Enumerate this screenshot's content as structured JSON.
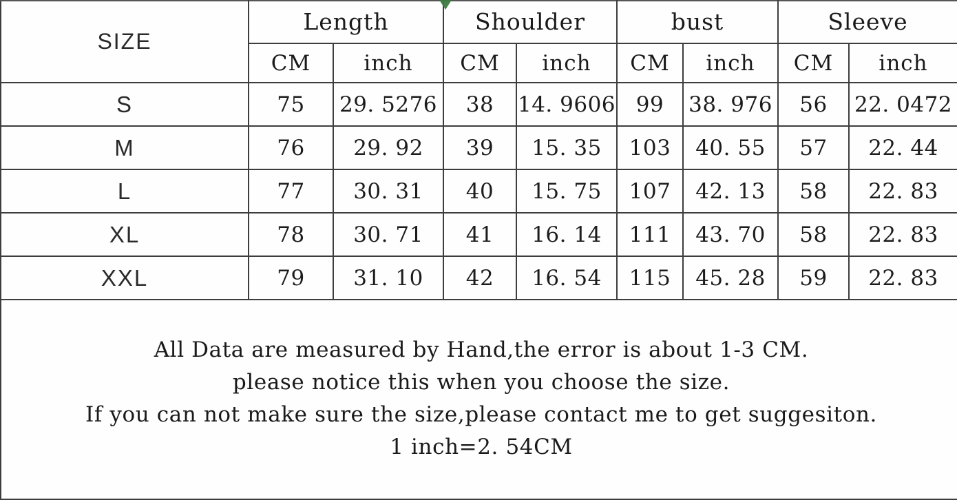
{
  "table": {
    "size_column_label": "SIZE",
    "groups": [
      {
        "label": "Length",
        "units": [
          "CM",
          "inch"
        ]
      },
      {
        "label": "Shoulder",
        "units": [
          "CM",
          "inch"
        ]
      },
      {
        "label": "bust",
        "units": [
          "CM",
          "inch"
        ]
      },
      {
        "label": "Sleeve",
        "units": [
          "CM",
          "inch"
        ]
      }
    ],
    "rows": [
      {
        "size": "S",
        "length_cm": "75",
        "length_inch": "29. 5276",
        "shoulder_cm": "38",
        "shoulder_inch": "14. 9606",
        "bust_cm": "99",
        "bust_inch": "38. 976",
        "sleeve_cm": "56",
        "sleeve_inch": "22. 0472"
      },
      {
        "size": "M",
        "length_cm": "76",
        "length_inch": "29. 92",
        "shoulder_cm": "39",
        "shoulder_inch": "15. 35",
        "bust_cm": "103",
        "bust_inch": "40. 55",
        "sleeve_cm": "57",
        "sleeve_inch": "22. 44"
      },
      {
        "size": "L",
        "length_cm": "77",
        "length_inch": "30. 31",
        "shoulder_cm": "40",
        "shoulder_inch": "15. 75",
        "bust_cm": "107",
        "bust_inch": "42. 13",
        "sleeve_cm": "58",
        "sleeve_inch": "22. 83"
      },
      {
        "size": "XL",
        "length_cm": "78",
        "length_inch": "30. 71",
        "shoulder_cm": "41",
        "shoulder_inch": "16. 14",
        "bust_cm": "111",
        "bust_inch": "43. 70",
        "sleeve_cm": "58",
        "sleeve_inch": "22. 83"
      },
      {
        "size": "XXL",
        "length_cm": "79",
        "length_inch": "31. 10",
        "shoulder_cm": "42",
        "shoulder_inch": "16. 54",
        "bust_cm": "115",
        "bust_inch": "45. 28",
        "sleeve_cm": "59",
        "sleeve_inch": "22. 83"
      }
    ]
  },
  "notes": {
    "line1": "All Data are measured by Hand,the error is about 1-3 CM.",
    "line2": "please notice this when you choose the size.",
    "line3": "If you can not make sure the size,please contact me to get suggesiton.",
    "line4": "1 inch=2. 54CM"
  },
  "colors": {
    "grid": "#3d3d3d",
    "text": "#1a1a1a",
    "background": "#fefefe",
    "marker_green": "#3f7a43"
  }
}
